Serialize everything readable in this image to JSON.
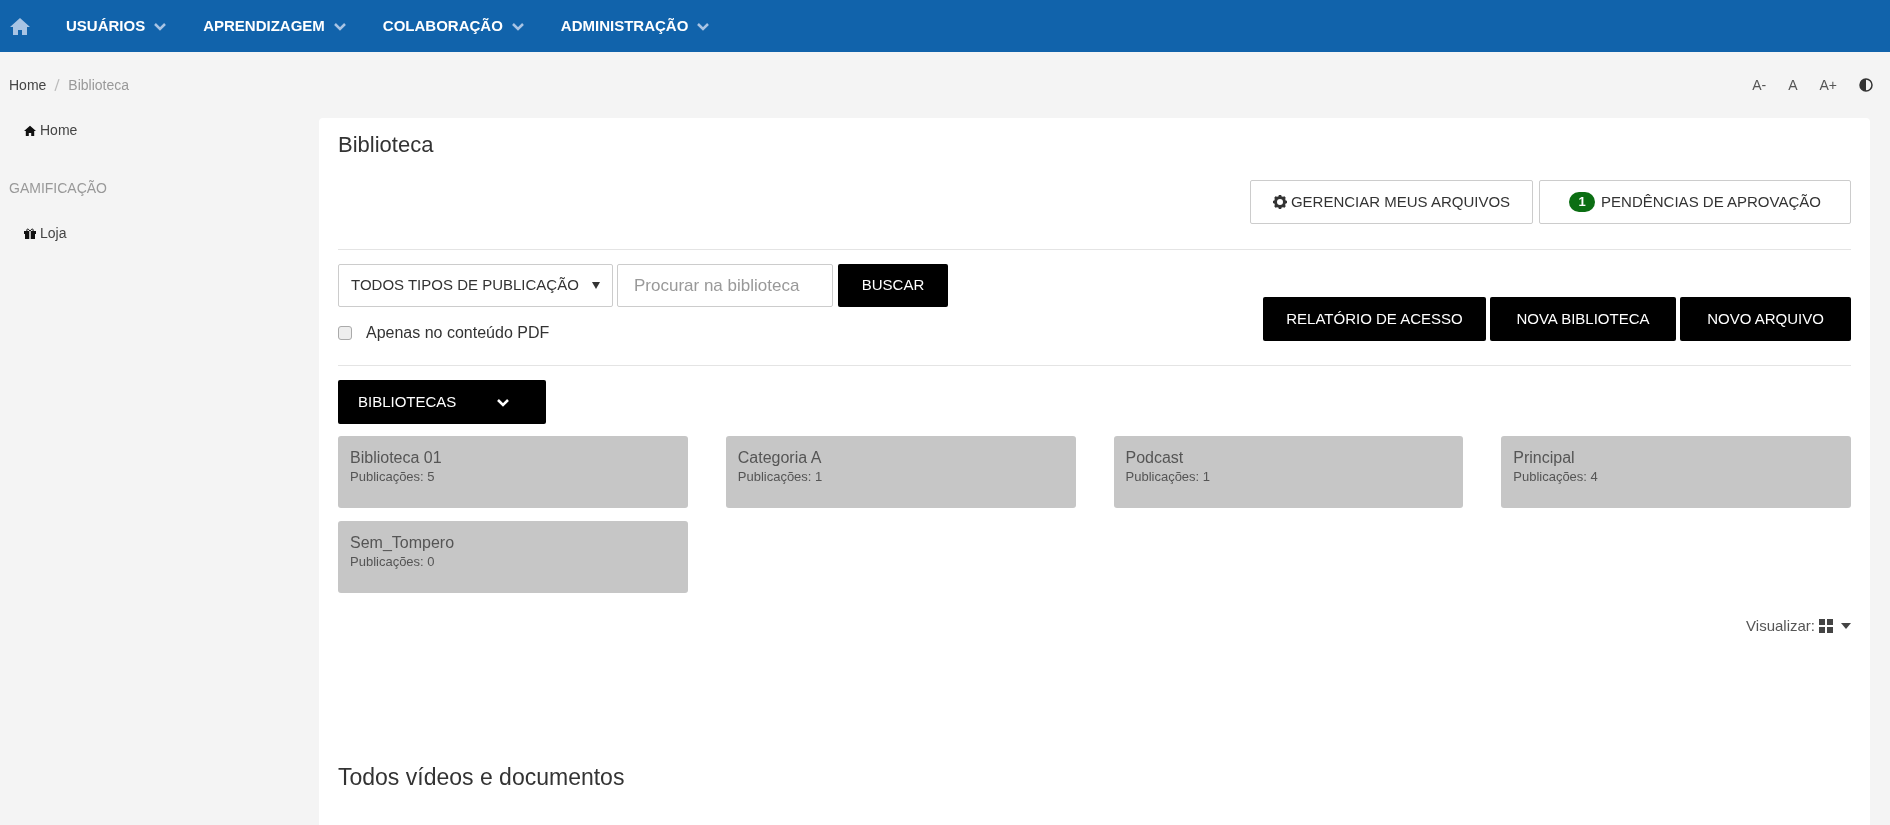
{
  "nav": {
    "items": [
      {
        "label": "USUÁRIOS"
      },
      {
        "label": "APRENDIZAGEM"
      },
      {
        "label": "COLABORAÇÃO"
      },
      {
        "label": "ADMINISTRAÇÃO"
      }
    ]
  },
  "breadcrumb": [
    {
      "label": "Home",
      "current": false
    },
    {
      "label": "Biblioteca",
      "current": true
    }
  ],
  "font_controls": [
    "A-",
    "A",
    "A+"
  ],
  "sidebar": {
    "items": [
      {
        "kind": "home_link",
        "label": "Home"
      },
      {
        "kind": "heading",
        "label": "GAMIFICAÇÃO"
      },
      {
        "kind": "shop_link",
        "label": "Loja"
      }
    ]
  },
  "page": {
    "title": "Biblioteca",
    "top_buttons": [
      {
        "kind": "gear",
        "label": "GERENCIAR MEUS ARQUIVOS"
      },
      {
        "kind": "badge",
        "badge": "1",
        "label": "PENDÊNCIAS DE APROVAÇÃO"
      }
    ],
    "type_select": {
      "value": "TODOS TIPOS DE PUBLICAÇÃO"
    },
    "search": {
      "placeholder": "Procurar na biblioteca"
    },
    "search_button": "BUSCAR",
    "pdf_only": {
      "label": "Apenas no conteúdo PDF",
      "checked": false
    },
    "action_buttons": [
      "RELATÓRIO DE ACESSO",
      "NOVA BIBLIOTECA",
      "NOVO ARQUIVO"
    ],
    "libraries_button": "BIBLIOTECAS",
    "libraries": [
      {
        "name": "Biblioteca 01",
        "count": "Publicações: 5"
      },
      {
        "name": "Categoria A",
        "count": "Publicações: 1"
      },
      {
        "name": "Podcast",
        "count": "Publicações: 1"
      },
      {
        "name": "Principal",
        "count": "Publicações: 4"
      },
      {
        "name": "Sem_Tompero",
        "count": "Publicações: 0"
      }
    ],
    "view_label": "Visualizar:",
    "section_title": "Todos vídeos e documentos"
  }
}
